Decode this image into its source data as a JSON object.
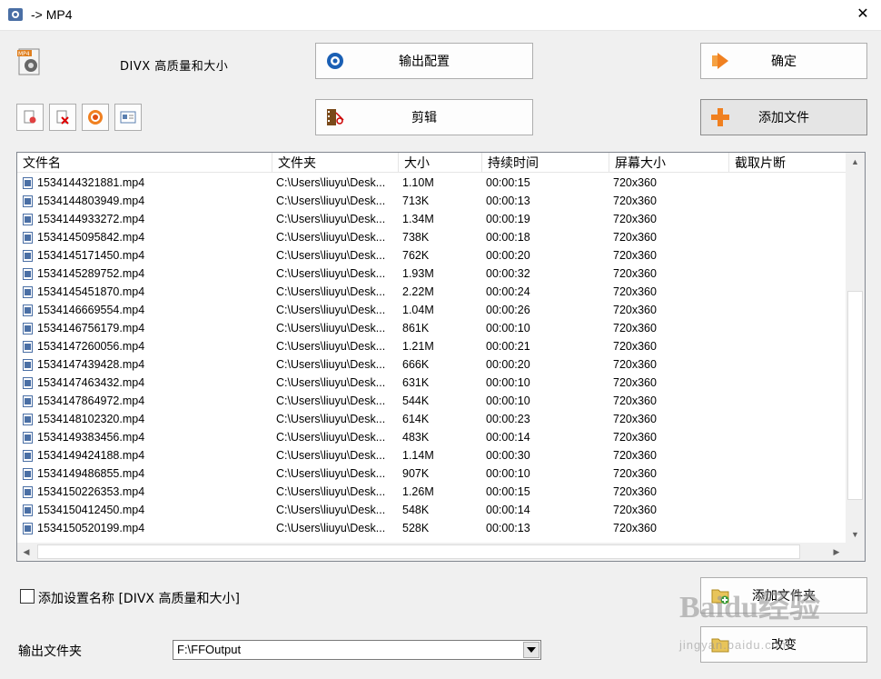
{
  "window": {
    "title": "-> MP4"
  },
  "preset": {
    "label": "DIVX 高质量和大小",
    "icon_badge": "MP4"
  },
  "buttons": {
    "output_config": "输出配置",
    "ok": "确定",
    "edit": "剪辑",
    "add_file": "添加文件",
    "add_folder": "添加文件夹",
    "change": "改变"
  },
  "table": {
    "columns": [
      "文件名",
      "文件夹",
      "大小",
      "持续时间",
      "屏幕大小",
      "截取片断"
    ],
    "rows": [
      {
        "name": "1534144321881.mp4",
        "folder": "C:\\Users\\liuyu\\Desk...",
        "size": "1.10M",
        "duration": "00:00:15",
        "screen": "720x360",
        "clip": ""
      },
      {
        "name": "1534144803949.mp4",
        "folder": "C:\\Users\\liuyu\\Desk...",
        "size": "713K",
        "duration": "00:00:13",
        "screen": "720x360",
        "clip": ""
      },
      {
        "name": "1534144933272.mp4",
        "folder": "C:\\Users\\liuyu\\Desk...",
        "size": "1.34M",
        "duration": "00:00:19",
        "screen": "720x360",
        "clip": ""
      },
      {
        "name": "1534145095842.mp4",
        "folder": "C:\\Users\\liuyu\\Desk...",
        "size": "738K",
        "duration": "00:00:18",
        "screen": "720x360",
        "clip": ""
      },
      {
        "name": "1534145171450.mp4",
        "folder": "C:\\Users\\liuyu\\Desk...",
        "size": "762K",
        "duration": "00:00:20",
        "screen": "720x360",
        "clip": ""
      },
      {
        "name": "1534145289752.mp4",
        "folder": "C:\\Users\\liuyu\\Desk...",
        "size": "1.93M",
        "duration": "00:00:32",
        "screen": "720x360",
        "clip": ""
      },
      {
        "name": "1534145451870.mp4",
        "folder": "C:\\Users\\liuyu\\Desk...",
        "size": "2.22M",
        "duration": "00:00:24",
        "screen": "720x360",
        "clip": ""
      },
      {
        "name": "1534146669554.mp4",
        "folder": "C:\\Users\\liuyu\\Desk...",
        "size": "1.04M",
        "duration": "00:00:26",
        "screen": "720x360",
        "clip": ""
      },
      {
        "name": "1534146756179.mp4",
        "folder": "C:\\Users\\liuyu\\Desk...",
        "size": "861K",
        "duration": "00:00:10",
        "screen": "720x360",
        "clip": ""
      },
      {
        "name": "1534147260056.mp4",
        "folder": "C:\\Users\\liuyu\\Desk...",
        "size": "1.21M",
        "duration": "00:00:21",
        "screen": "720x360",
        "clip": ""
      },
      {
        "name": "1534147439428.mp4",
        "folder": "C:\\Users\\liuyu\\Desk...",
        "size": "666K",
        "duration": "00:00:20",
        "screen": "720x360",
        "clip": ""
      },
      {
        "name": "1534147463432.mp4",
        "folder": "C:\\Users\\liuyu\\Desk...",
        "size": "631K",
        "duration": "00:00:10",
        "screen": "720x360",
        "clip": ""
      },
      {
        "name": "1534147864972.mp4",
        "folder": "C:\\Users\\liuyu\\Desk...",
        "size": "544K",
        "duration": "00:00:10",
        "screen": "720x360",
        "clip": ""
      },
      {
        "name": "1534148102320.mp4",
        "folder": "C:\\Users\\liuyu\\Desk...",
        "size": "614K",
        "duration": "00:00:23",
        "screen": "720x360",
        "clip": ""
      },
      {
        "name": "1534149383456.mp4",
        "folder": "C:\\Users\\liuyu\\Desk...",
        "size": "483K",
        "duration": "00:00:14",
        "screen": "720x360",
        "clip": ""
      },
      {
        "name": "1534149424188.mp4",
        "folder": "C:\\Users\\liuyu\\Desk...",
        "size": "1.14M",
        "duration": "00:00:30",
        "screen": "720x360",
        "clip": ""
      },
      {
        "name": "1534149486855.mp4",
        "folder": "C:\\Users\\liuyu\\Desk...",
        "size": "907K",
        "duration": "00:00:10",
        "screen": "720x360",
        "clip": ""
      },
      {
        "name": "1534150226353.mp4",
        "folder": "C:\\Users\\liuyu\\Desk...",
        "size": "1.26M",
        "duration": "00:00:15",
        "screen": "720x360",
        "clip": ""
      },
      {
        "name": "1534150412450.mp4",
        "folder": "C:\\Users\\liuyu\\Desk...",
        "size": "548K",
        "duration": "00:00:14",
        "screen": "720x360",
        "clip": ""
      },
      {
        "name": "1534150520199.mp4",
        "folder": "C:\\Users\\liuyu\\Desk...",
        "size": "528K",
        "duration": "00:00:13",
        "screen": "720x360",
        "clip": ""
      }
    ]
  },
  "options": {
    "add_setting_name_label": "添加设置名称 [DIVX 高质量和大小]"
  },
  "output": {
    "label": "输出文件夹",
    "folder": "F:\\FFOutput"
  },
  "watermark": {
    "text": "Baidu经验",
    "sub": "jingyan.baidu.com"
  },
  "colors": {
    "accent_orange": "#f08020",
    "accent_blue": "#1a5fb4",
    "window_bg": "#f0f0f0"
  }
}
